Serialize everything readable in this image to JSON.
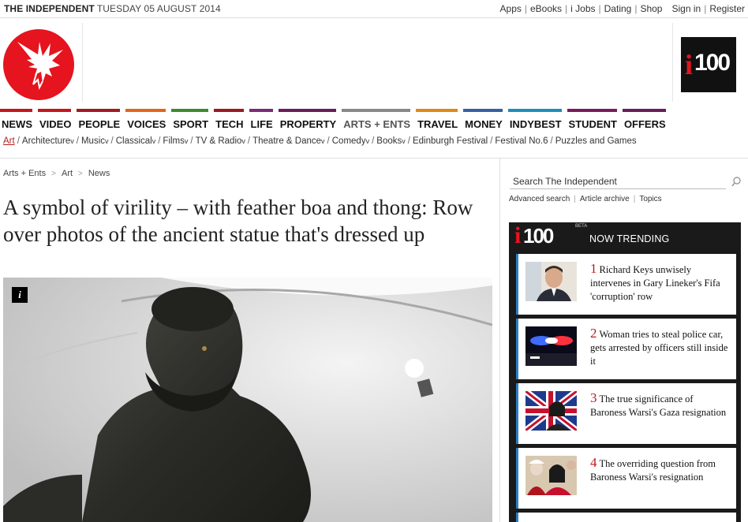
{
  "topbar": {
    "brand": "THE INDEPENDENT",
    "date": "TUESDAY 05 AUGUST 2014",
    "links": [
      "Apps",
      "eBooks",
      "i Jobs",
      "Dating",
      "Shop"
    ],
    "sign_in": "Sign in",
    "register": "Register"
  },
  "mainnav": [
    {
      "label": "NEWS",
      "color": "#c4161c"
    },
    {
      "label": "VIDEO",
      "color": "#c4161c"
    },
    {
      "label": "PEOPLE",
      "color": "#a3191f"
    },
    {
      "label": "VOICES",
      "color": "#e0661a"
    },
    {
      "label": "SPORT",
      "color": "#3e8b2d"
    },
    {
      "label": "TECH",
      "color": "#9a1a1f"
    },
    {
      "label": "LIFE",
      "color": "#7a2a78"
    },
    {
      "label": "PROPERTY",
      "color": "#6b1a5c"
    },
    {
      "label": "ARTS + ENTS",
      "color": "#888888"
    },
    {
      "label": "TRAVEL",
      "color": "#e0881a"
    },
    {
      "label": "MONEY",
      "color": "#3560a3"
    },
    {
      "label": "INDYBEST",
      "color": "#1a8fb8"
    },
    {
      "label": "STUDENT",
      "color": "#7a1a5c"
    },
    {
      "label": "OFFERS",
      "color": "#6b1a5c"
    }
  ],
  "subnav": [
    "Art",
    "Architecture",
    "Music",
    "Classical",
    "Films",
    "TV & Radio",
    "Theatre & Dance",
    "Comedy",
    "Books",
    "Edinburgh Festival",
    "Festival No.6",
    "Puzzles and Games"
  ],
  "subnav_dropdown_marker": "v",
  "breadcrumb": [
    "Arts + Ents",
    "Art",
    "News"
  ],
  "breadcrumb_sep": ">",
  "headline": "A symbol of virility – with feather boa and thong: Row over photos of the ancient statue that's dressed up",
  "hero": {
    "info_label": "i"
  },
  "search": {
    "placeholder": "Search The Independent",
    "links": [
      "Advanced search",
      "Article archive",
      "Topics"
    ]
  },
  "trending": {
    "logo_i": "i",
    "logo_num": "100",
    "beta": "BETA",
    "label": "NOW TRENDING",
    "items": [
      {
        "rank": "1",
        "text": "Richard Keys unwisely intervenes in Gary Lineker's Fifa 'corruption' row"
      },
      {
        "rank": "2",
        "text": "Woman tries to steal police car, gets arrested by officers still inside it"
      },
      {
        "rank": "3",
        "text": "The true significance of Baroness Warsi's Gaza resignation"
      },
      {
        "rank": "4",
        "text": "The overriding question from Baroness Warsi's resignation"
      }
    ]
  },
  "i100_logo": {
    "i": "i",
    "num": "100"
  },
  "colors": {
    "brand_red": "#e5141e",
    "accent_blue": "#2a7fc4",
    "trend_bg": "#1a1a1a"
  }
}
